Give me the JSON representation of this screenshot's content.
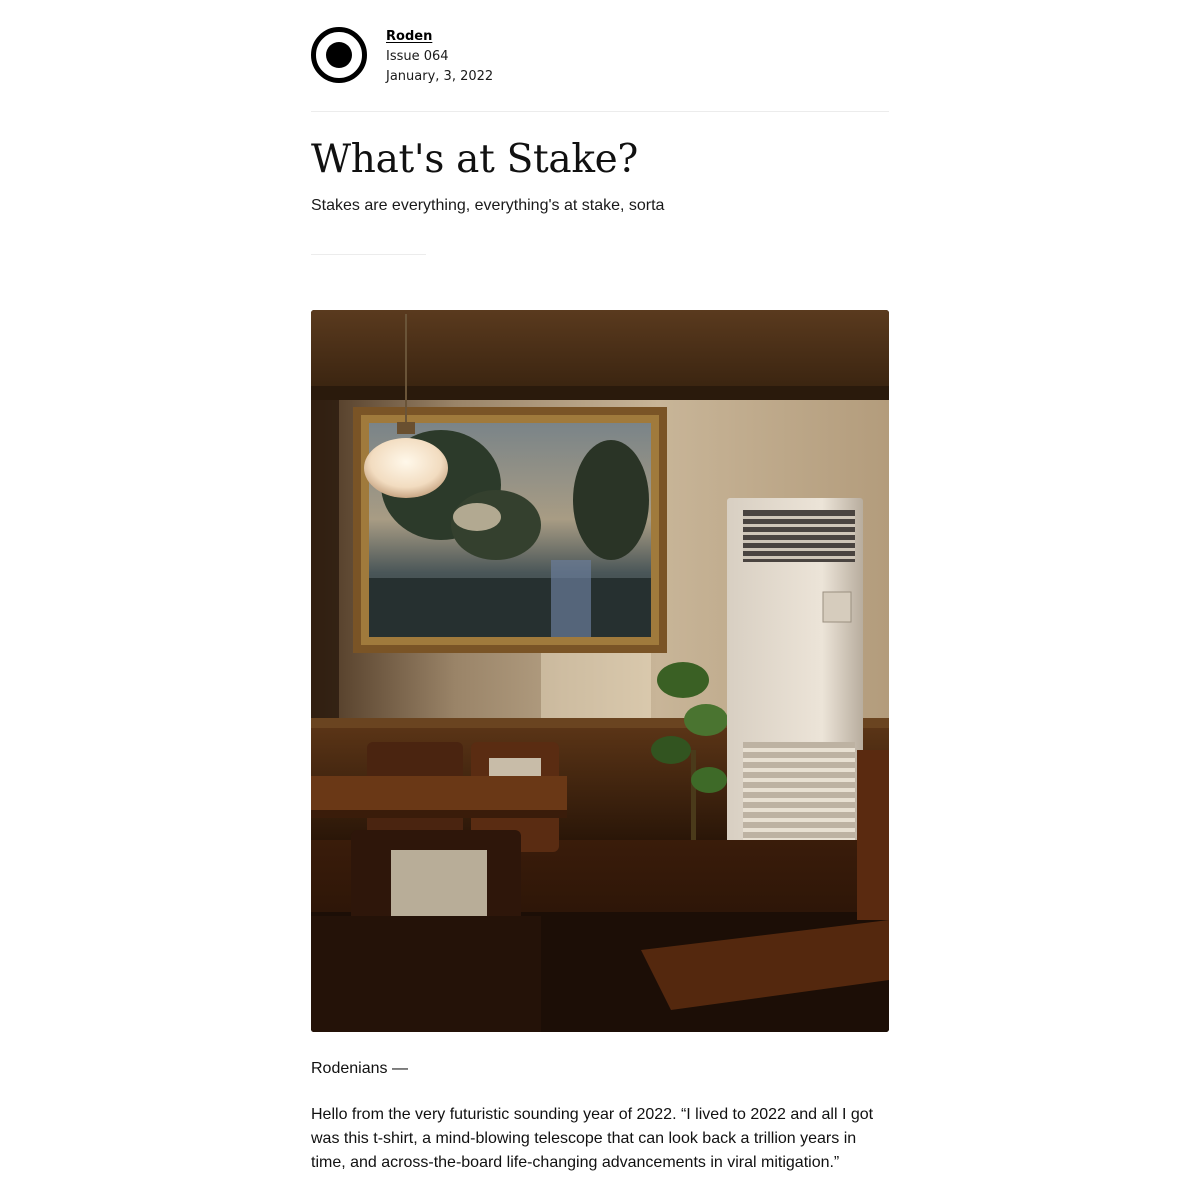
{
  "publication": {
    "name": "Roden",
    "issue": "Issue 064",
    "date": "January, 3, 2022"
  },
  "article": {
    "title": "What's at Stake?",
    "subtitle": "Stakes are everything, everything's at stake, sorta",
    "salutation": "Rodenians —",
    "paragraphs": [
      "Hello from the very futuristic sounding year of 2022. “I lived to 2022 and all I got was this t-shirt, a mind-blowing telescope that can look back a trillion years in time, and across-the-board life-changing advancements in viral mitigation.”"
    ]
  },
  "icons": {
    "logo": "circle-dot-logo-icon"
  },
  "colors": {
    "background": "#ffffff",
    "text": "#111111",
    "rule": "#ececec",
    "logo": "#000000"
  }
}
